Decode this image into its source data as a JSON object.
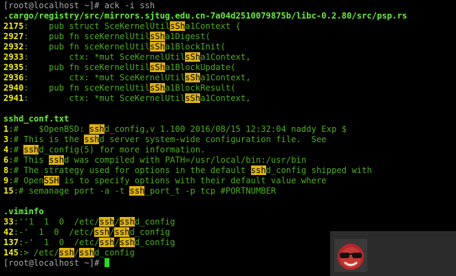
{
  "prompt1": "[root@localhost ~]# ack -i ssh",
  "groups": [
    {
      "file": ".cargo/registry/src/mirrors.sjtug.edu.cn-7a04d2510079875b/libc-0.2.80/src/psp.rs",
      "lines": [
        {
          "num": "2175",
          "segs": [
            {
              "t": "    pub struct SceKernelUtil"
            },
            {
              "t": "sSh",
              "h": 1
            },
            {
              "t": "a1Context {"
            }
          ]
        },
        {
          "num": "2927",
          "segs": [
            {
              "t": "    pub fn sceKernelUtil"
            },
            {
              "t": "sSh",
              "h": 1
            },
            {
              "t": "a1Digest("
            }
          ]
        },
        {
          "num": "2932",
          "segs": [
            {
              "t": "    pub fn sceKernelUtil"
            },
            {
              "t": "sSh",
              "h": 1
            },
            {
              "t": "a1BlockInit("
            }
          ]
        },
        {
          "num": "2933",
          "segs": [
            {
              "t": "        ctx: *mut SceKernelUtil"
            },
            {
              "t": "sSh",
              "h": 1
            },
            {
              "t": "a1Context,"
            }
          ]
        },
        {
          "num": "2935",
          "segs": [
            {
              "t": "    pub fn sceKernelUtil"
            },
            {
              "t": "sSh",
              "h": 1
            },
            {
              "t": "a1BlockUpdate("
            }
          ]
        },
        {
          "num": "2936",
          "segs": [
            {
              "t": "        ctx: *mut SceKernelUtil"
            },
            {
              "t": "sSh",
              "h": 1
            },
            {
              "t": "a1Context,"
            }
          ]
        },
        {
          "num": "2940",
          "segs": [
            {
              "t": "    pub fn sceKernelUtil"
            },
            {
              "t": "sSh",
              "h": 1
            },
            {
              "t": "a1BlockResult("
            }
          ]
        },
        {
          "num": "2941",
          "segs": [
            {
              "t": "        ctx: *mut SceKernelUtil"
            },
            {
              "t": "sSh",
              "h": 1
            },
            {
              "t": "a1Context,"
            }
          ]
        }
      ]
    },
    {
      "file": "sshd_conf.txt",
      "lines": [
        {
          "num": "1",
          "segs": [
            {
              "t": "#    $OpenBSD: "
            },
            {
              "t": "ssh",
              "h": 1
            },
            {
              "t": "d_config,v 1.100 2016/08/15 12:32:04 naddy Exp $"
            }
          ]
        },
        {
          "num": "3",
          "segs": [
            {
              "t": "# This is the "
            },
            {
              "t": "ssh",
              "h": 1
            },
            {
              "t": "d server system-wide configuration file.  See"
            }
          ]
        },
        {
          "num": "4",
          "segs": [
            {
              "t": "# "
            },
            {
              "t": "ssh",
              "h": 1
            },
            {
              "t": "d_config(5) for more information."
            }
          ]
        },
        {
          "num": "6",
          "segs": [
            {
              "t": "# This "
            },
            {
              "t": "ssh",
              "h": 1
            },
            {
              "t": "d was compiled with PATH=/usr/local/bin:/usr/bin"
            }
          ]
        },
        {
          "num": "8",
          "segs": [
            {
              "t": "# The strategy used for options in the default "
            },
            {
              "t": "ssh",
              "h": 1
            },
            {
              "t": "d_config shipped with"
            }
          ]
        },
        {
          "num": "9",
          "segs": [
            {
              "t": "# Open"
            },
            {
              "t": "SSH",
              "h": 1
            },
            {
              "t": " is to specify options with their default value where"
            }
          ]
        },
        {
          "num": "15",
          "segs": [
            {
              "t": "# semanage port -a -t "
            },
            {
              "t": "ssh",
              "h": 1
            },
            {
              "t": "_port_t -p tcp #PORTNUMBER"
            }
          ]
        }
      ]
    },
    {
      "file": ".viminfo",
      "lines": [
        {
          "num": "33",
          "segs": [
            {
              "t": "''1  1  0  /etc/"
            },
            {
              "t": "ssh",
              "h": 1
            },
            {
              "t": "/"
            },
            {
              "t": "ssh",
              "h": 1
            },
            {
              "t": "d_config"
            }
          ]
        },
        {
          "num": "42",
          "segs": [
            {
              "t": "-'  1  0  /etc/"
            },
            {
              "t": "ssh",
              "h": 1
            },
            {
              "t": "/"
            },
            {
              "t": "ssh",
              "h": 1
            },
            {
              "t": "d_config"
            }
          ]
        },
        {
          "num": "137",
          "segs": [
            {
              "t": "-'  1  0  /etc/"
            },
            {
              "t": "ssh",
              "h": 1
            },
            {
              "t": "/"
            },
            {
              "t": "ssh",
              "h": 1
            },
            {
              "t": "d_config"
            }
          ]
        },
        {
          "num": "145",
          "segs": [
            {
              "t": "> /etc/"
            },
            {
              "t": "ssh",
              "h": 1
            },
            {
              "t": "/"
            },
            {
              "t": "ssh",
              "h": 1
            },
            {
              "t": "d_config"
            }
          ]
        }
      ]
    }
  ],
  "prompt2": "[root@localhost ~]# ",
  "colors": {
    "file": "#66ef3a",
    "line_number": "#f4f400",
    "match_bg": "#e0b40b",
    "code": "#4bb01a",
    "cursor": "#21e21a"
  },
  "overlay_icon": "smiling-face-with-sunglasses-icon"
}
